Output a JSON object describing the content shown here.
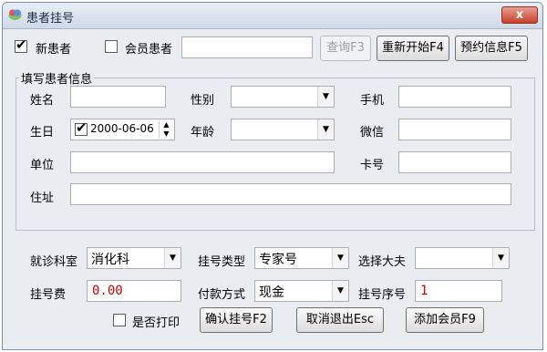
{
  "window": {
    "title": "患者挂号",
    "close_label": "x"
  },
  "top": {
    "new_patient_label": "新患者",
    "new_patient_checked": true,
    "member_patient_label": "会员患者",
    "member_patient_checked": false,
    "member_input_value": "",
    "query_button": "查询F3",
    "restart_button": "重新开始F4",
    "appointment_button": "预约信息F5"
  },
  "patient_info": {
    "group_title": "填写患者信息",
    "name_label": "姓名",
    "name_value": "",
    "gender_label": "性别",
    "gender_value": "",
    "mobile_label": "手机",
    "mobile_value": "",
    "birthday_label": "生日",
    "birthday_checked": true,
    "birthday_value": "2000-06-06",
    "age_label": "年龄",
    "age_value": "",
    "wechat_label": "微信",
    "wechat_value": "",
    "company_label": "单位",
    "company_value": "",
    "card_label": "卡号",
    "card_value": "",
    "address_label": "住址",
    "address_value": ""
  },
  "registration": {
    "department_label": "就诊科室",
    "department_value": "消化科",
    "reg_type_label": "挂号类型",
    "reg_type_value": "专家号",
    "doctor_label": "选择大夫",
    "doctor_value": "",
    "fee_label": "挂号费",
    "fee_value": "0.00",
    "payment_label": "付款方式",
    "payment_value": "现金",
    "serial_label": "挂号序号",
    "serial_value": "1",
    "print_label": "是否打印",
    "print_checked": false,
    "confirm_button": "确认挂号F2",
    "cancel_button": "取消退出Esc",
    "add_member_button": "添加会员F9"
  },
  "colors": {
    "fee_text": "#d40000",
    "close_button": "#c9402b"
  }
}
